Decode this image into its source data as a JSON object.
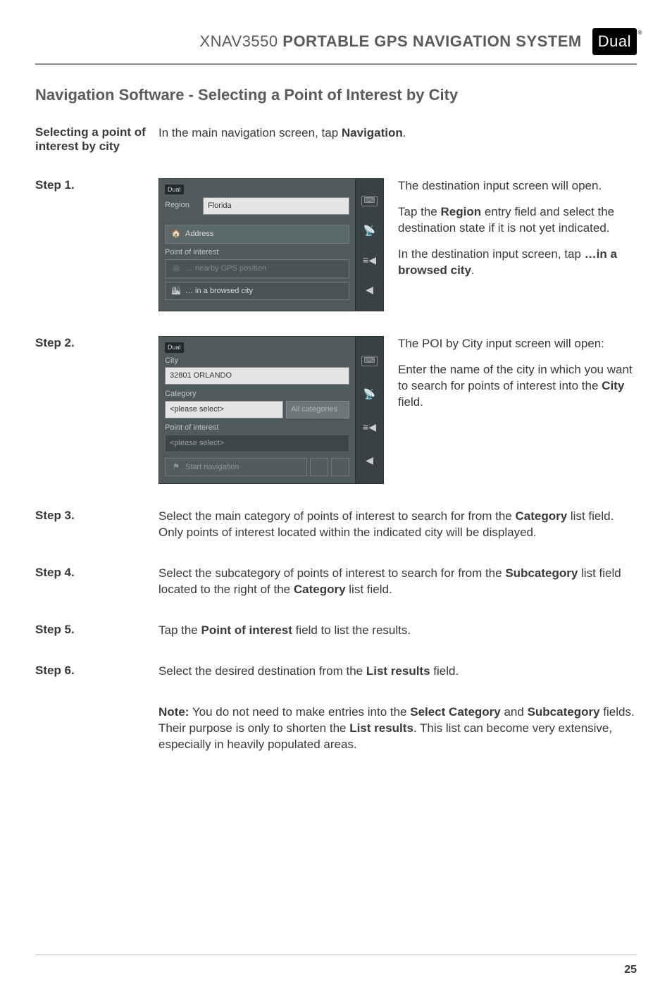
{
  "header": {
    "product": "XNAV3550",
    "subtitle": "PORTABLE GPS NAVIGATION SYSTEM",
    "brand": "Dual"
  },
  "section_title": "Navigation Software - Selecting a Point of Interest by City",
  "intro_label": "Selecting a point of interest by city",
  "intro_text_pre": "In the main navigation screen, tap ",
  "intro_text_bold": "Navigation",
  "intro_text_post": ".",
  "step1": {
    "label": "Step 1.",
    "right": {
      "p1": "The destination input screen will open.",
      "p2_pre": "Tap the ",
      "p2_bold": "Region",
      "p2_post": " entry field and select the destination state if it is not yet indicated.",
      "p3_pre": "In the destination input screen, tap ",
      "p3_bold": "…in a browsed city",
      "p3_post": "."
    },
    "shot": {
      "logo": "Dual",
      "region_label": "Region",
      "region_value": "Florida",
      "address_btn": "Address",
      "poi_label": "Point of interest",
      "nearby_btn": "… nearby GPS position",
      "browsed_btn": "… in a browsed city"
    }
  },
  "step2": {
    "label": "Step 2.",
    "right": {
      "p1": "The POI by City input screen will open:",
      "p2_pre": "Enter the name of the city in which you want to search for points of interest into the ",
      "p2_bold": "City",
      "p2_post": " field."
    },
    "shot": {
      "logo": "Dual",
      "city_label": "City",
      "city_value": "32801 ORLANDO",
      "category_label": "Category",
      "category_value": "<please select>",
      "allcat_btn": "All categories",
      "poi_label": "Point of interest",
      "poi_value": "<please select>",
      "start_btn": "Start navigation"
    }
  },
  "step3": {
    "label": "Step 3.",
    "p_pre": "Select the main category of points of interest to search for from the ",
    "p_bold": "Category",
    "p_post": " list field. Only points of interest located within the indicated city will be displayed."
  },
  "step4": {
    "label": "Step 4.",
    "p_pre": "Select the subcategory of points of interest to search for from the ",
    "p_bold1": "Subcategory",
    "p_mid": " list field located to the right of the ",
    "p_bold2": "Category",
    "p_post": " list field."
  },
  "step5": {
    "label": "Step 5.",
    "p_pre": "Tap the ",
    "p_bold": "Point of interest",
    "p_post": " field to list the results."
  },
  "step6": {
    "label": "Step 6.",
    "p_pre": "Select the desired destination from the ",
    "p_bold": "List results",
    "p_post": " field."
  },
  "note": {
    "pre": "Note:",
    "t1": " You do not need to make entries into the ",
    "b1": "Select Category",
    "t2": " and ",
    "b2": "Subcategory",
    "t3": " fields. Their purpose is only to shorten the ",
    "b3": "List results",
    "t4": ". This list can become very extensive, especially in heavily populated areas."
  },
  "page_number": "25"
}
